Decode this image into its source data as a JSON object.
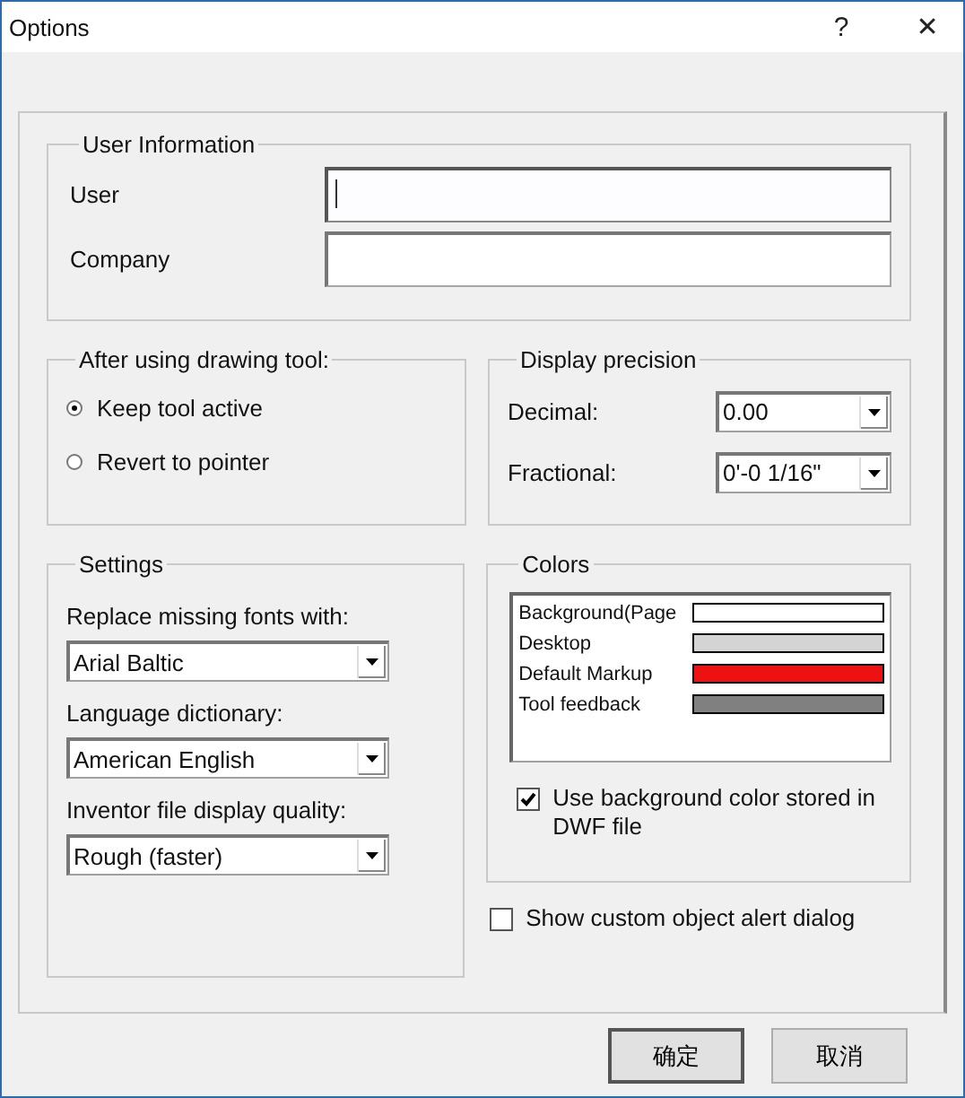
{
  "window": {
    "title": "Options",
    "help": "?",
    "close": "✕"
  },
  "user_information": {
    "title": "User Information",
    "fields": [
      {
        "label": "User",
        "focused": true
      },
      {
        "label": "Company",
        "focused": false
      }
    ]
  },
  "after_using_drawing_tool": {
    "title": "After using drawing tool:",
    "options": [
      {
        "label": "Keep tool active",
        "selected": true
      },
      {
        "label": "Revert to pointer",
        "selected": false
      }
    ]
  },
  "display_precision": {
    "title": "Display precision",
    "fields": [
      {
        "label": "Decimal:",
        "value": "0.00"
      },
      {
        "label": "Fractional:",
        "value": "0'-0 1/16\""
      }
    ]
  },
  "settings": {
    "title": "Settings",
    "fields": [
      {
        "label": "Replace missing fonts with:",
        "value": "Arial Baltic"
      },
      {
        "label": "Language dictionary:",
        "value": "American English"
      },
      {
        "label": "Inventor file display quality:",
        "value": "Rough (faster)"
      }
    ]
  },
  "colors": {
    "title": "Colors",
    "items": [
      {
        "label": "Background(Page",
        "color": "#ffffff"
      },
      {
        "label": "Desktop",
        "color": "#d4d4d4"
      },
      {
        "label": "Default Markup",
        "color": "#ee1111"
      },
      {
        "label": "Tool feedback",
        "color": "#808080"
      }
    ],
    "use_background_color": {
      "label": "Use background color stored in DWF file",
      "checked": true
    }
  },
  "show_custom_object_alert": {
    "label": "Show custom object alert dialog",
    "checked": false
  },
  "buttons": [
    "确定",
    "取消"
  ]
}
